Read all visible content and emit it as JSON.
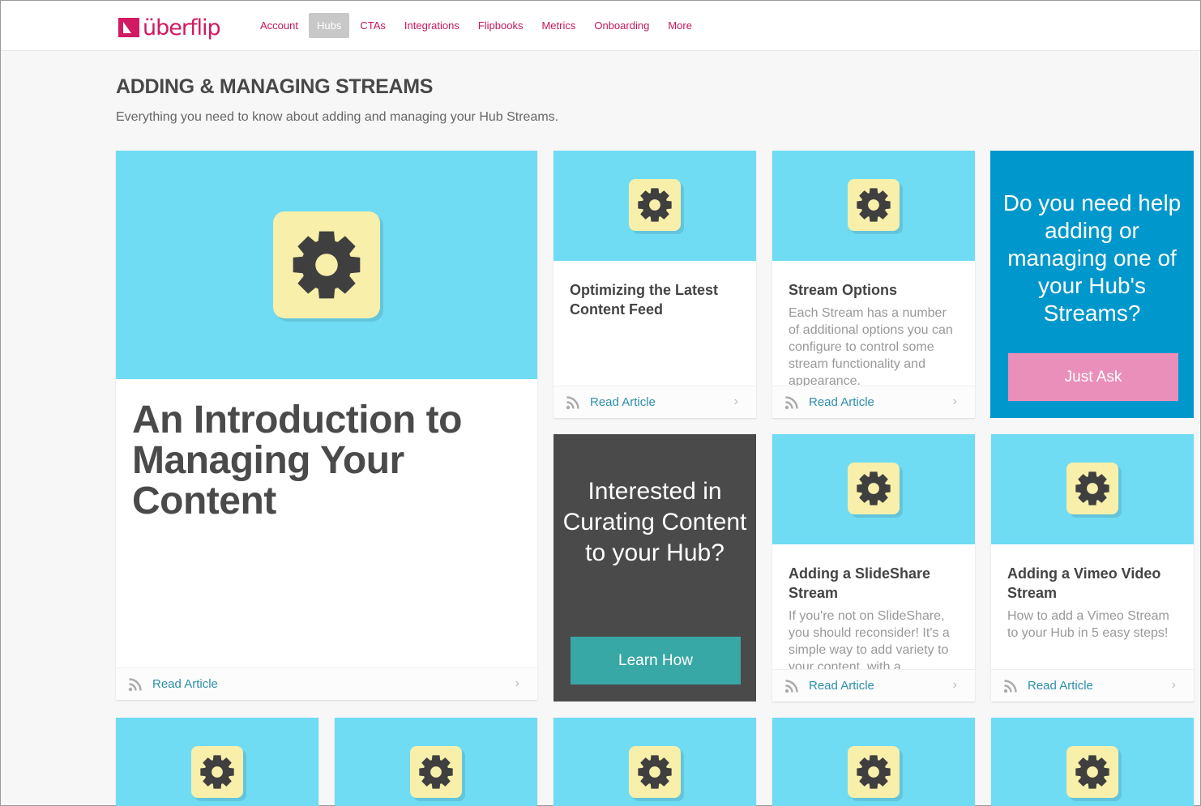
{
  "brand": {
    "logo_text": "überflip",
    "accent": "#d11a61"
  },
  "nav": {
    "items": [
      "Account",
      "Hubs",
      "CTAs",
      "Integrations",
      "Flipbooks",
      "Metrics",
      "Onboarding",
      "More"
    ],
    "active": "Hubs"
  },
  "page": {
    "title": "ADDING & MANAGING STREAMS",
    "subtitle": "Everything you need to know about adding and managing your Hub Streams."
  },
  "featured": {
    "title": "An Introduction to Managing Your Content",
    "link": "Read Article",
    "icon": "gear-icon"
  },
  "cards": [
    {
      "title": "Optimizing the Latest Content Feed",
      "desc": "",
      "link": "Read Article"
    },
    {
      "title": "Stream Options",
      "desc": "Each Stream has a number of additional options you can configure to control some stream functionality and appearance.",
      "link": "Read Article"
    },
    {
      "title": "Adding a SlideShare Stream",
      "desc": "If you're not on SlideShare, you should reconsider! It's a simple way to add variety to your content, with a",
      "link": "Read Article"
    },
    {
      "title": "Adding a Vimeo Video Stream",
      "desc": "How to add a Vimeo Stream to your Hub in 5 easy steps!",
      "link": "Read Article"
    }
  ],
  "cta_help": {
    "question": "Do you need help adding or managing one of your Hub's Streams?",
    "button": "Just Ask",
    "bg": "#0097cc",
    "button_bg": "#e98fb9"
  },
  "cta_curate": {
    "question": "Interested in Curating Content to your Hub?",
    "button": "Learn How",
    "bg": "#4a4a4a",
    "button_bg": "#38a8a6"
  }
}
